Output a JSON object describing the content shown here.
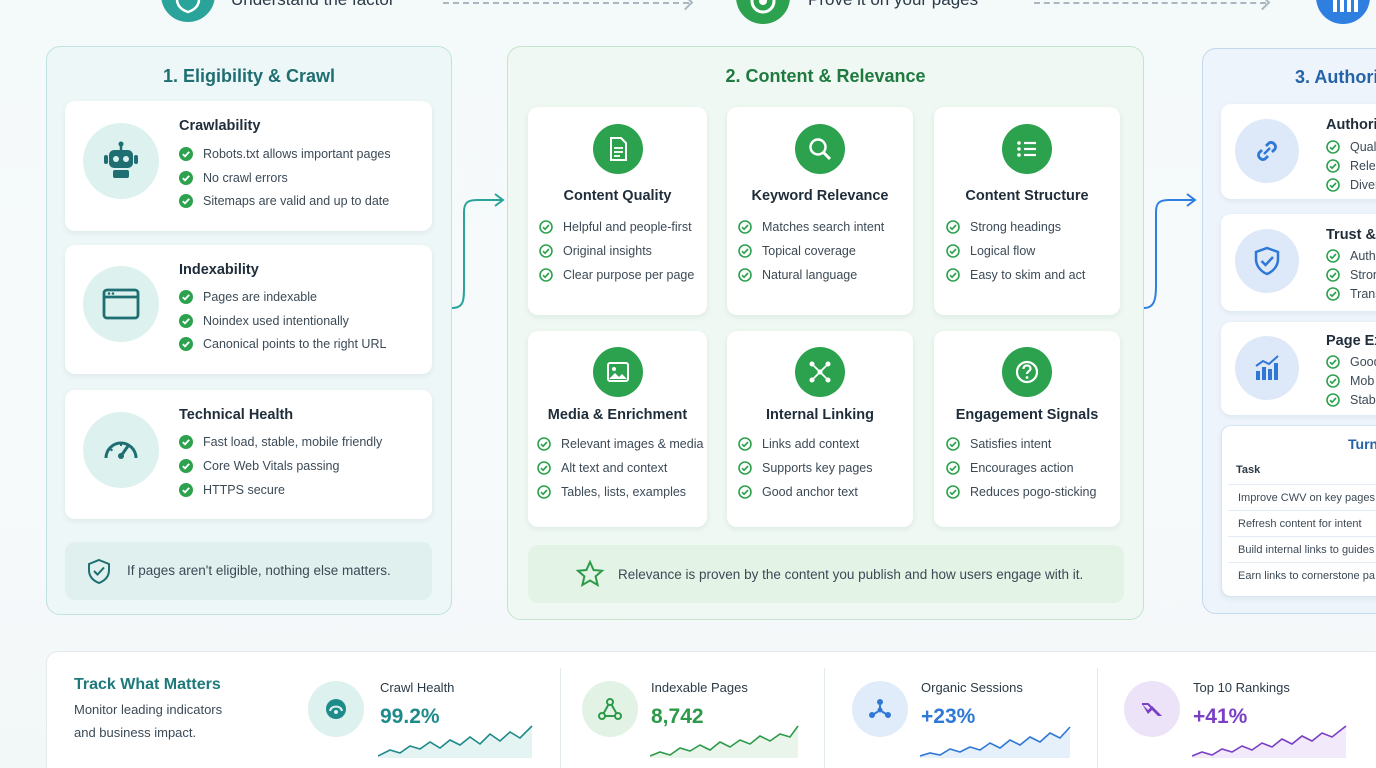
{
  "top_steps": [
    {
      "label": "Understand the factor",
      "color": "#2aa39a"
    },
    {
      "label": "Prove it on your pages",
      "color": "#2da24e"
    },
    {
      "label": "",
      "color": "#2f7fe0"
    }
  ],
  "panel1": {
    "title": "1. Eligibility & Crawl",
    "cards": [
      {
        "title": "Crawlability",
        "icon": "robot-icon",
        "items": [
          "Robots.txt allows important pages",
          "No crawl errors",
          "Sitemaps are valid and up to date"
        ]
      },
      {
        "title": "Indexability",
        "icon": "browser-window-icon",
        "items": [
          "Pages are indexable",
          "Noindex used intentionally",
          "Canonical points to the right URL"
        ]
      },
      {
        "title": "Technical Health",
        "icon": "speedometer-icon",
        "items": [
          "Fast load, stable, mobile friendly",
          "Core Web Vitals passing",
          "HTTPS secure"
        ]
      }
    ],
    "note": "If pages aren't eligible, nothing else matters."
  },
  "panel2": {
    "title": "2. Content & Relevance",
    "cards": [
      {
        "title": "Content Quality",
        "icon": "document-icon",
        "items": [
          "Helpful and people-first",
          "Original insights",
          "Clear purpose per page"
        ]
      },
      {
        "title": "Keyword Relevance",
        "icon": "search-icon",
        "items": [
          "Matches search intent",
          "Topical coverage",
          "Natural language"
        ]
      },
      {
        "title": "Content Structure",
        "icon": "list-icon",
        "items": [
          "Strong headings",
          "Logical flow",
          "Easy to skim and act"
        ]
      },
      {
        "title": "Media & Enrichment",
        "icon": "image-icon",
        "items": [
          "Relevant images & media",
          "Alt text and context",
          "Tables, lists, examples"
        ]
      },
      {
        "title": "Internal Linking",
        "icon": "network-icon",
        "items": [
          "Links add context",
          "Supports key pages",
          "Good anchor text"
        ]
      },
      {
        "title": "Engagement Signals",
        "icon": "question-icon",
        "items": [
          "Satisfies intent",
          "Encourages action",
          "Reduces pogo-sticking"
        ]
      }
    ],
    "note": "Relevance is proven by the content you publish and how users engage with it."
  },
  "panel3": {
    "title": "3. Authori",
    "cards": [
      {
        "title": "Authori",
        "icon": "link-icon",
        "items": [
          "Qual",
          "Relev",
          "Diver"
        ]
      },
      {
        "title": "Trust &",
        "icon": "shield-check-icon",
        "items": [
          "Auth",
          "Stron",
          "Trans"
        ]
      },
      {
        "title": "Page Ex",
        "icon": "bar-chart-icon",
        "items": [
          "Good",
          "Mob",
          "Stab"
        ]
      }
    ],
    "turn": {
      "title": "Turn",
      "header": "Task",
      "rows": [
        "Improve CWV on key pages",
        "Refresh content for intent",
        "Build internal links to guides",
        "Earn links to cornerstone pa"
      ]
    }
  },
  "bottom": {
    "title": "Track What Matters",
    "subtitle_line1": "Monitor leading indicators",
    "subtitle_line2": "and business impact.",
    "metrics": [
      {
        "label": "Crawl Health",
        "value": "99.2%",
        "color": "#1e8a8a",
        "bg": "#ddf1ef",
        "icon": "crawl-health-icon"
      },
      {
        "label": "Indexable Pages",
        "value": "8,742",
        "color": "#2d9a4a",
        "bg": "#e2f3e6",
        "icon": "indexable-pages-icon"
      },
      {
        "label": "Organic Sessions",
        "value": "+23%",
        "color": "#2f78d6",
        "bg": "#e0ecfa",
        "icon": "organic-sessions-icon"
      },
      {
        "label": "Top 10 Rankings",
        "value": "+41%",
        "color": "#7a3fc4",
        "bg": "#ede3f8",
        "icon": "rankings-icon"
      }
    ]
  },
  "colors": {
    "teal": "#2aa39a",
    "green": "#2da24e",
    "blue": "#2f7fe0",
    "purple": "#7a3fc4"
  }
}
